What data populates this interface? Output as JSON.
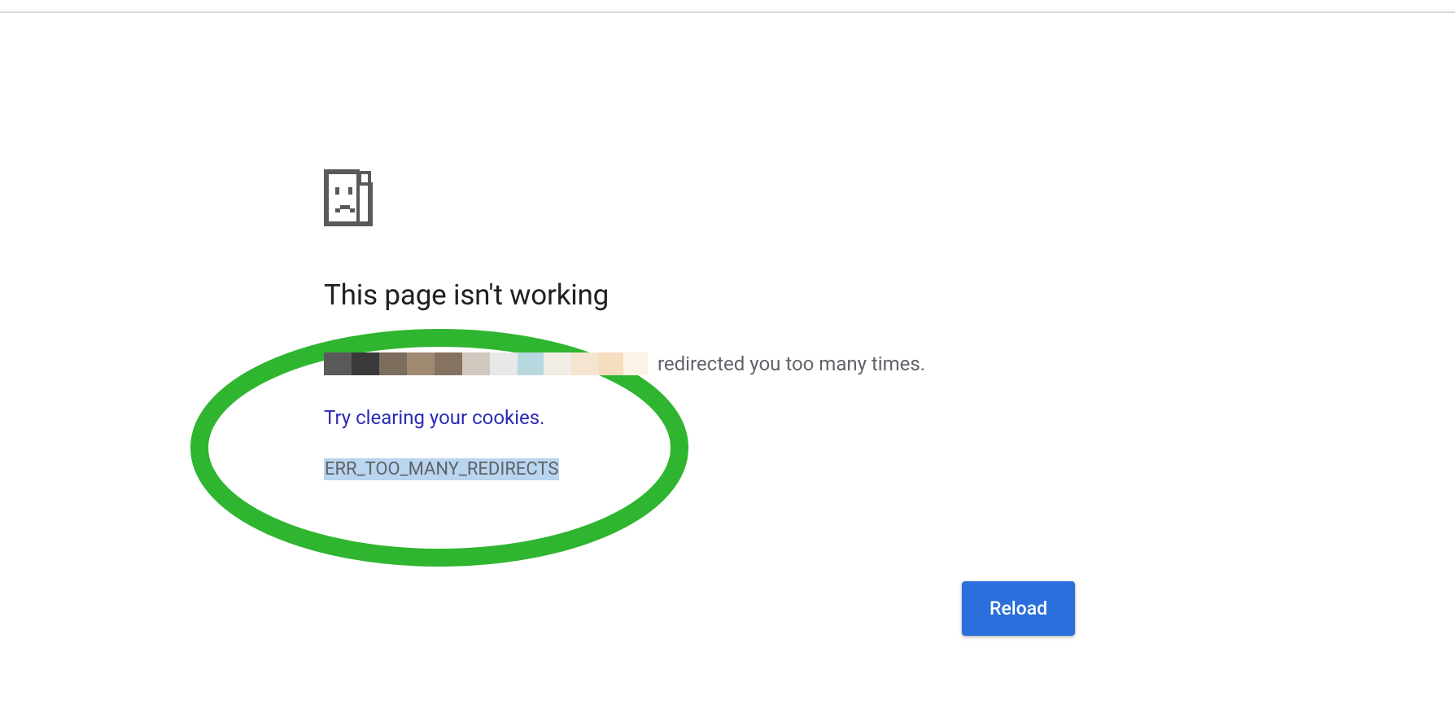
{
  "error_page": {
    "heading": "This page isn't working",
    "message_suffix": "redirected you too many times.",
    "cookie_link_text": "Try clearing your cookies.",
    "error_code": "ERR_TOO_MANY_REDIRECTS",
    "reload_button_label": "Reload"
  }
}
